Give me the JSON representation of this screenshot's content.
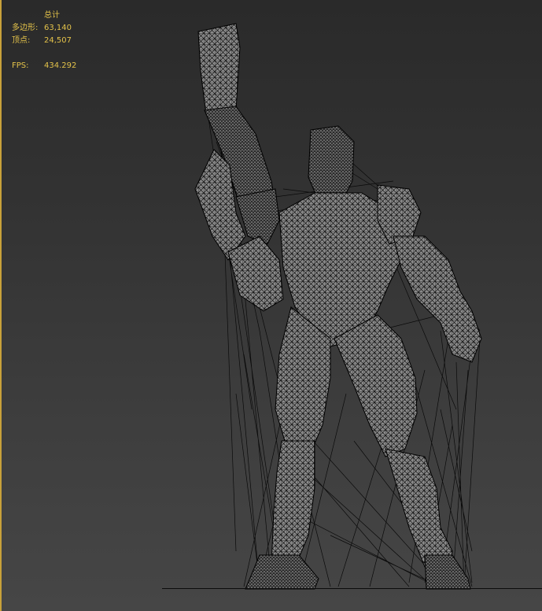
{
  "viewport": {
    "stats_header": "总计",
    "stats": [
      {
        "label": "多边形:",
        "value": "63,140"
      },
      {
        "label": "顶点:",
        "value": "24,507"
      }
    ],
    "fps_label": "FPS:",
    "fps_value": "434.292",
    "border_color": "#c8a13a",
    "text_color": "#e3c24a"
  }
}
